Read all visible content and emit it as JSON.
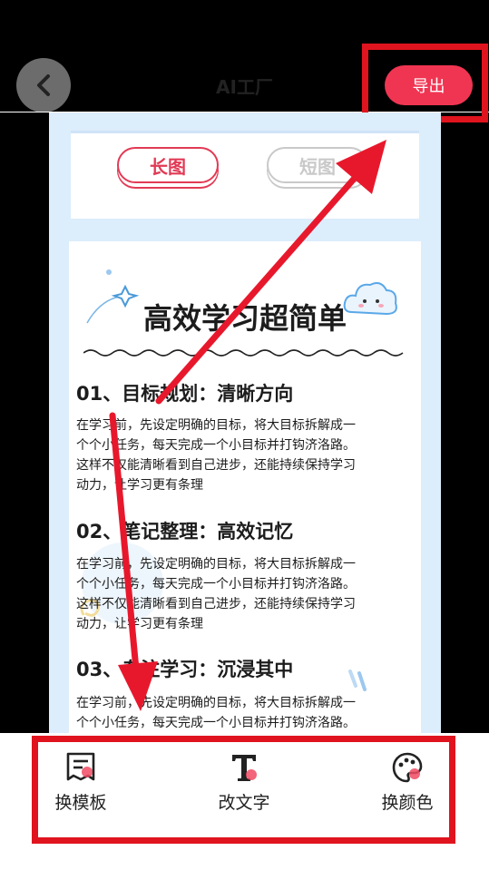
{
  "header": {
    "title": "AI工厂",
    "export_label": "导出"
  },
  "toggle": {
    "long_label": "长图",
    "short_label": "短图"
  },
  "article": {
    "title": "高效学习超简单",
    "sections": [
      {
        "heading": "01、目标规划：清晰方向",
        "lines": [
          "在学习前，先设定明确的目标，将大目标拆解成一",
          "个个小任务，每天完成一个小目标并打钩济洛路。",
          "这样不仅能清晰看到自己进步，还能持续保持学习",
          "动力，让学习更有条理"
        ]
      },
      {
        "heading": "02、笔记整理：高效记忆",
        "lines": [
          "在学习前，先设定明确的目标，将大目标拆解成一",
          "个个小任务，每天完成一个小目标并打钩济洛路。",
          "这样不仅能清晰看到自己进步，还能持续保持学习",
          "动力，让学习更有条理"
        ]
      },
      {
        "heading": "03、专注学习：沉浸其中",
        "lines": [
          "在学习前，先设定明确的目标，将大目标拆解成一",
          "个个小任务，每天完成一个小目标并打钩济洛路。"
        ]
      }
    ]
  },
  "toolbar": {
    "template_label": "换模板",
    "text_label": "改文字",
    "color_label": "换颜色"
  },
  "colors": {
    "accent": "#f03552",
    "highlight": "#e0141e",
    "preview_bg": "#dcedfb"
  }
}
